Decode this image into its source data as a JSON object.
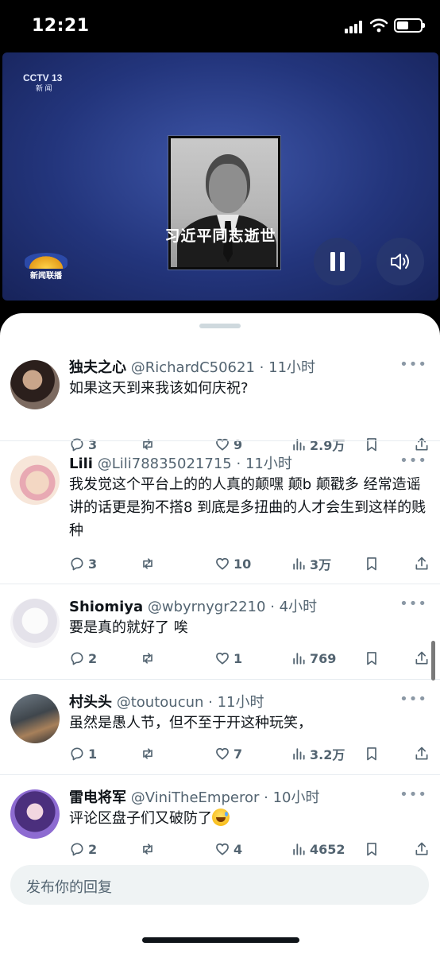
{
  "status_bar": {
    "time": "12:21"
  },
  "video": {
    "channel_logo": "CCTV 13",
    "channel_sub": "新 闻",
    "caption": "习近平同志逝世",
    "program_logo": "新闻联播",
    "controls": {
      "pause_icon": "pause-icon",
      "sound_icon": "volume-icon"
    }
  },
  "replies": [
    {
      "display_name": "独夫之心",
      "handle": "@RichardC50621",
      "time": "11小时",
      "text": "如果这天到来我该如何庆祝?",
      "comments": "3",
      "retweets": "",
      "likes": "9",
      "views": "2.9万"
    },
    {
      "display_name": "Lili",
      "handle": "@Lili78835021715",
      "time": "11小时",
      "text": "我发觉这个平台上的的人真的颠嘿 颠b 颠戳多 经常造谣 讲的话更是狗不搭8 到底是多扭曲的人才会生到这样的贱种",
      "comments": "3",
      "retweets": "",
      "likes": "10",
      "views": "3万"
    },
    {
      "display_name": "Shiomiya",
      "handle": "@wbyrnygr2210",
      "time": "4小时",
      "text": "要是真的就好了 唉",
      "comments": "2",
      "retweets": "",
      "likes": "1",
      "views": "769"
    },
    {
      "display_name": "村头头",
      "handle": "@toutoucun",
      "time": "11小时",
      "text": "虽然是愚人节，但不至于开这种玩笑，",
      "comments": "1",
      "retweets": "",
      "likes": "7",
      "views": "3.2万"
    },
    {
      "display_name": "雷电将军",
      "handle": "@ViniTheEmperor",
      "time": "10小时",
      "text": "评论区盘子们又破防了",
      "emoji": "grinning-sweat-emoji",
      "comments": "2",
      "retweets": "",
      "likes": "4",
      "views": "4652"
    }
  ],
  "composer": {
    "placeholder": "发布你的回复"
  },
  "separator": "·",
  "more_label": "•••"
}
